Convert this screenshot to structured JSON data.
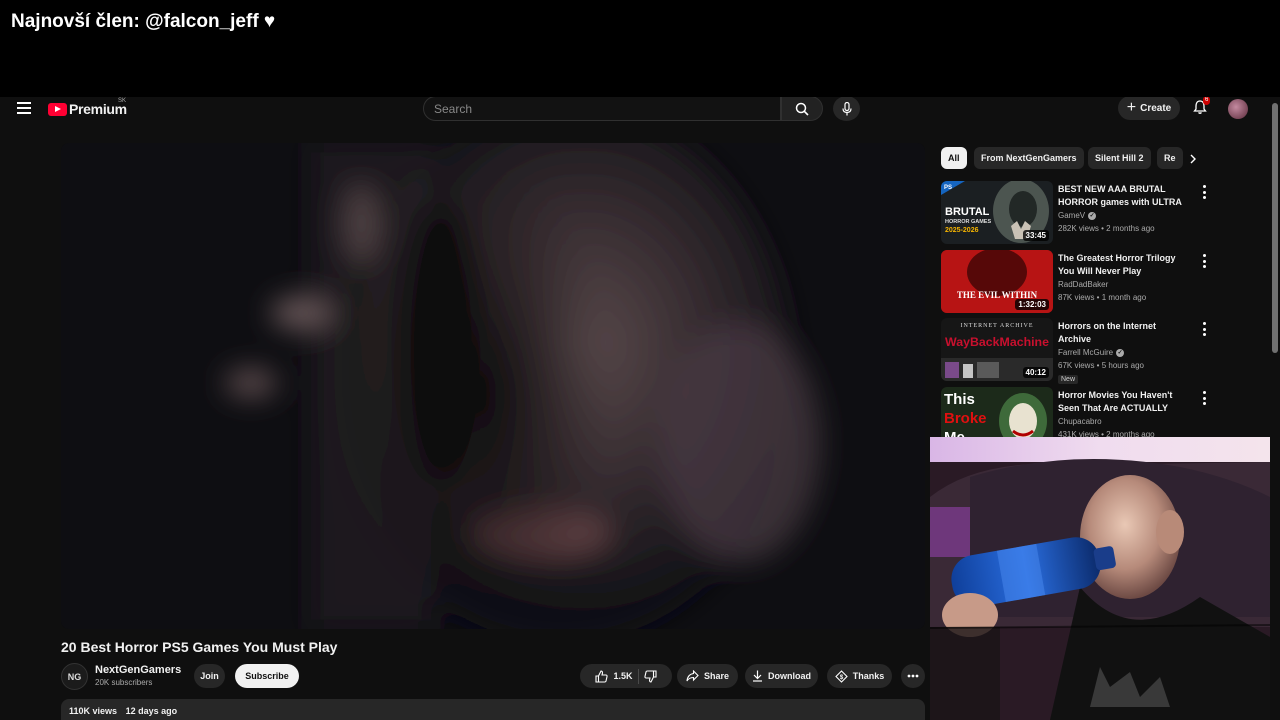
{
  "overlay": {
    "banner_text": "Najnovší člen: @falcon_jeff ♥"
  },
  "masthead": {
    "logo_text": "Premium",
    "country_code": "SK",
    "search_placeholder": "Search",
    "create_label": "Create",
    "notification_count": "6"
  },
  "video": {
    "title": "20 Best Horror PS5 Games You Must Play",
    "channel_name": "NextGenGamers",
    "channel_initials": "NG",
    "subscribers": "20K subscribers",
    "join_label": "Join",
    "subscribe_label": "Subscribe",
    "likes": "1.5K",
    "share_label": "Share",
    "download_label": "Download",
    "thanks_label": "Thanks",
    "views": "110K views",
    "age": "12 days ago"
  },
  "sidebar": {
    "chips": [
      {
        "label": "All",
        "active": true
      },
      {
        "label": "From NextGenGamers",
        "active": false
      },
      {
        "label": "Silent Hill 2",
        "active": false
      },
      {
        "label": "Re",
        "active": false
      }
    ],
    "recommendations": [
      {
        "title": "BEST NEW AAA BRUTAL HORROR games with ULTRA ...",
        "channel": "GameV",
        "verified": true,
        "meta": "282K views • 2 months ago",
        "duration": "33:45",
        "thumb_text": [
          "BRUTAL",
          "HORROR GAMES",
          "2025-2026"
        ],
        "badge": ""
      },
      {
        "title": "The Greatest Horror Trilogy You Will Never Play",
        "channel": "RadDadBaker",
        "verified": false,
        "meta": "87K views • 1 month ago",
        "duration": "1:32:03",
        "thumb_text": [
          "THE EVIL WITHIN"
        ],
        "badge": ""
      },
      {
        "title": "Horrors on the Internet Archive",
        "channel": "Farrell McGuire",
        "verified": true,
        "meta": "67K views • 5 hours ago",
        "duration": "40:12",
        "thumb_text": [
          "INTERNET ARCHIVE",
          "WayBackMachine"
        ],
        "badge": "New"
      },
      {
        "title": "Horror Movies You Haven't Seen That Are ACTUALLY Terrifying",
        "channel": "Chupacabro",
        "verified": false,
        "meta": "431K views • 2 months ago",
        "duration": "",
        "thumb_text": [
          "This",
          "Broke",
          "Me"
        ],
        "badge": ""
      }
    ]
  },
  "colors": {
    "background": "#0f0f0f",
    "brand_red": "#ff0033",
    "chip": "#272727",
    "text": "#f1f1f1",
    "muted": "#aaaaaa"
  }
}
